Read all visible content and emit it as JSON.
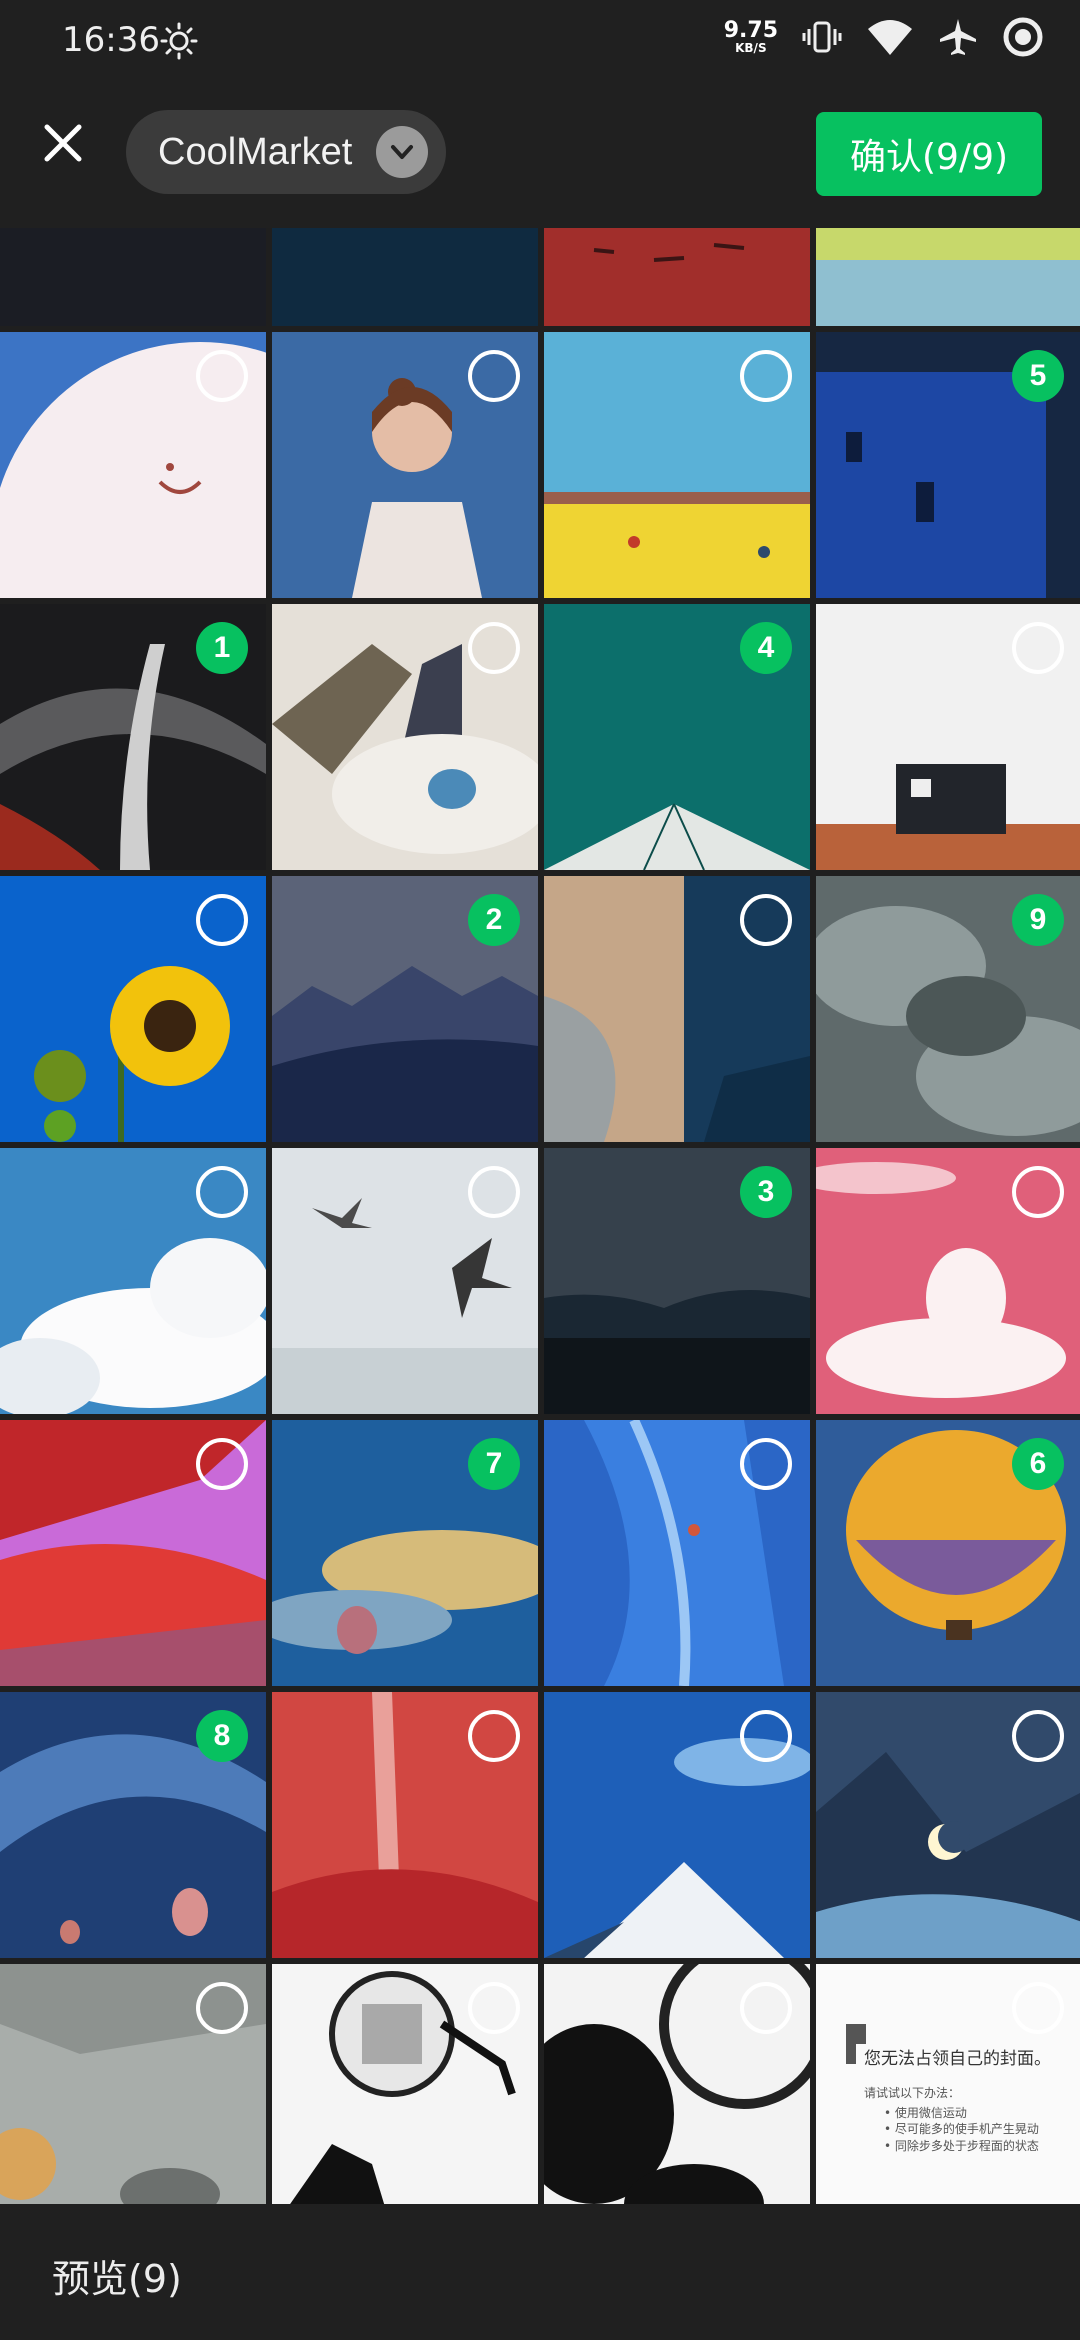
{
  "status_bar": {
    "time": "16:36",
    "net_speed": "9.75",
    "net_unit": "KB/S",
    "icons": [
      "brightness-icon",
      "vibrate-icon",
      "wifi-icon",
      "airplane-mode-icon",
      "record-icon"
    ]
  },
  "header": {
    "album": "CoolMarket",
    "confirm_label": "确认(9/9)",
    "accent": "#07c160"
  },
  "footer": {
    "preview_label": "预览(9)"
  },
  "thumbnails": [
    {
      "art": "pink-phone",
      "selected": null
    },
    {
      "art": "orange-figure-water",
      "selected": null
    },
    {
      "art": "rocks-red-sea",
      "selected": null
    },
    {
      "art": "sky-field-stripes",
      "selected": null
    },
    {
      "art": "white-moon-face",
      "selected": null
    },
    {
      "art": "girl-portrait",
      "selected": null
    },
    {
      "art": "yellow-field-kites",
      "selected": null
    },
    {
      "art": "blue-building",
      "selected": "5"
    },
    {
      "art": "dark-tree",
      "selected": "1"
    },
    {
      "art": "sleeping-figure",
      "selected": null
    },
    {
      "art": "teal-roof",
      "selected": "4"
    },
    {
      "art": "white-wall-container",
      "selected": null
    },
    {
      "art": "sunflower",
      "selected": null
    },
    {
      "art": "mountains-grey",
      "selected": "2"
    },
    {
      "art": "sky-split",
      "selected": null
    },
    {
      "art": "grey-clouds",
      "selected": "9"
    },
    {
      "art": "white-clouds-blue",
      "selected": null
    },
    {
      "art": "seagulls-fog",
      "selected": null
    },
    {
      "art": "dark-hills-dusk",
      "selected": "3"
    },
    {
      "art": "pink-sky-clouds",
      "selected": null
    },
    {
      "art": "red-clouds-purple",
      "selected": null
    },
    {
      "art": "balloon-sky",
      "selected": "7"
    },
    {
      "art": "blue-ice-climber",
      "selected": null
    },
    {
      "art": "hot-air-balloon",
      "selected": "6"
    },
    {
      "art": "blue-swirl-balloons",
      "selected": "8"
    },
    {
      "art": "red-waterfall",
      "selected": null
    },
    {
      "art": "snow-peak",
      "selected": null
    },
    {
      "art": "moon-valley",
      "selected": null
    },
    {
      "art": "cookie-tray",
      "selected": null
    },
    {
      "art": "meme-face",
      "selected": null
    },
    {
      "art": "panda-wheel",
      "selected": null
    },
    {
      "art": "dino-offline",
      "selected": null
    }
  ],
  "screenshot_tile": {
    "title": "您无法占领自己的封面。",
    "hint": "请试试以下办法：",
    "tips": [
      "使用微信运动",
      "尽可能多的使手机产生晃动",
      "同除步多处于步程面的状态"
    ]
  }
}
